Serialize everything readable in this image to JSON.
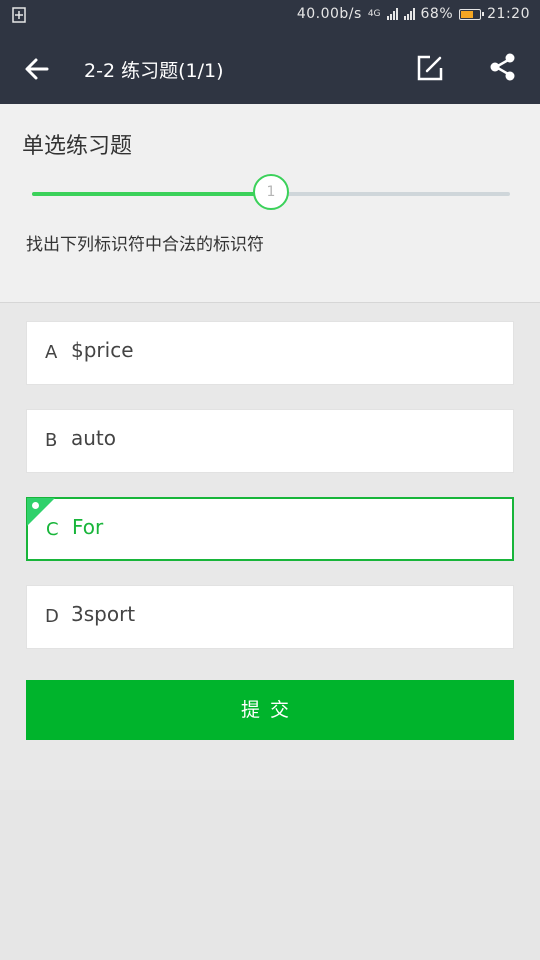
{
  "status_bar": {
    "speed": "40.00b/s",
    "network": "4G",
    "battery": "68%",
    "battery_level": 0.68,
    "time": "21:20"
  },
  "toolbar": {
    "title": "2-2 练习题(1/1)"
  },
  "question": {
    "type_label": "单选练习题",
    "progress_value": "1",
    "progress_fraction": 0.5,
    "text": "找出下列标识符中合法的标识符"
  },
  "options": [
    {
      "letter": "A",
      "text": "$price",
      "selected": false
    },
    {
      "letter": "B",
      "text": "auto",
      "selected": false
    },
    {
      "letter": "C",
      "text": "For",
      "selected": true
    },
    {
      "letter": "D",
      "text": "3sport",
      "selected": false
    }
  ],
  "submit_label": "提交",
  "colors": {
    "header_bg": "#2f3542",
    "accent_green": "#00b42c",
    "slider_green": "#3bd15a"
  },
  "icons": [
    "back-arrow-icon",
    "edit-icon",
    "share-icon"
  ]
}
